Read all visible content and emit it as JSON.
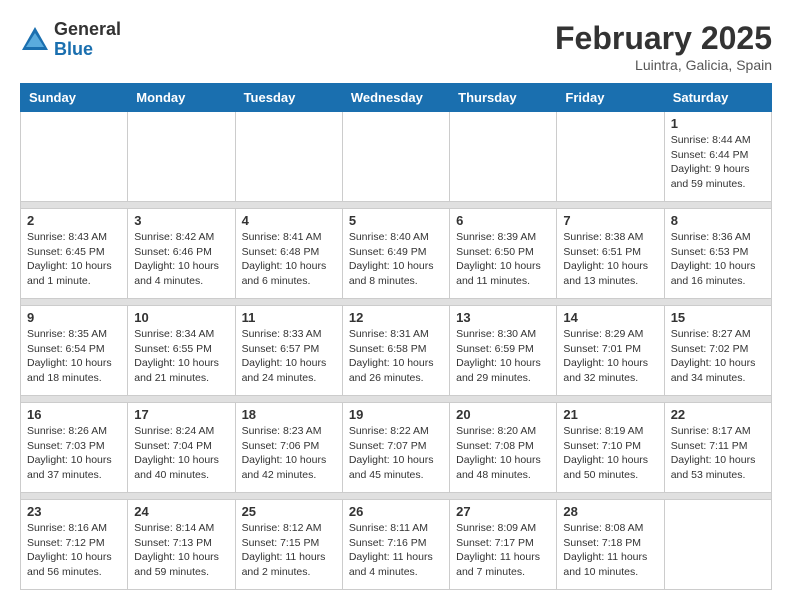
{
  "logo": {
    "general": "General",
    "blue": "Blue"
  },
  "title": {
    "month_year": "February 2025",
    "location": "Luintra, Galicia, Spain"
  },
  "weekdays": [
    "Sunday",
    "Monday",
    "Tuesday",
    "Wednesday",
    "Thursday",
    "Friday",
    "Saturday"
  ],
  "weeks": [
    [
      {
        "day": "",
        "info": ""
      },
      {
        "day": "",
        "info": ""
      },
      {
        "day": "",
        "info": ""
      },
      {
        "day": "",
        "info": ""
      },
      {
        "day": "",
        "info": ""
      },
      {
        "day": "",
        "info": ""
      },
      {
        "day": "1",
        "info": "Sunrise: 8:44 AM\nSunset: 6:44 PM\nDaylight: 9 hours and 59 minutes."
      }
    ],
    [
      {
        "day": "2",
        "info": "Sunrise: 8:43 AM\nSunset: 6:45 PM\nDaylight: 10 hours and 1 minute."
      },
      {
        "day": "3",
        "info": "Sunrise: 8:42 AM\nSunset: 6:46 PM\nDaylight: 10 hours and 4 minutes."
      },
      {
        "day": "4",
        "info": "Sunrise: 8:41 AM\nSunset: 6:48 PM\nDaylight: 10 hours and 6 minutes."
      },
      {
        "day": "5",
        "info": "Sunrise: 8:40 AM\nSunset: 6:49 PM\nDaylight: 10 hours and 8 minutes."
      },
      {
        "day": "6",
        "info": "Sunrise: 8:39 AM\nSunset: 6:50 PM\nDaylight: 10 hours and 11 minutes."
      },
      {
        "day": "7",
        "info": "Sunrise: 8:38 AM\nSunset: 6:51 PM\nDaylight: 10 hours and 13 minutes."
      },
      {
        "day": "8",
        "info": "Sunrise: 8:36 AM\nSunset: 6:53 PM\nDaylight: 10 hours and 16 minutes."
      }
    ],
    [
      {
        "day": "9",
        "info": "Sunrise: 8:35 AM\nSunset: 6:54 PM\nDaylight: 10 hours and 18 minutes."
      },
      {
        "day": "10",
        "info": "Sunrise: 8:34 AM\nSunset: 6:55 PM\nDaylight: 10 hours and 21 minutes."
      },
      {
        "day": "11",
        "info": "Sunrise: 8:33 AM\nSunset: 6:57 PM\nDaylight: 10 hours and 24 minutes."
      },
      {
        "day": "12",
        "info": "Sunrise: 8:31 AM\nSunset: 6:58 PM\nDaylight: 10 hours and 26 minutes."
      },
      {
        "day": "13",
        "info": "Sunrise: 8:30 AM\nSunset: 6:59 PM\nDaylight: 10 hours and 29 minutes."
      },
      {
        "day": "14",
        "info": "Sunrise: 8:29 AM\nSunset: 7:01 PM\nDaylight: 10 hours and 32 minutes."
      },
      {
        "day": "15",
        "info": "Sunrise: 8:27 AM\nSunset: 7:02 PM\nDaylight: 10 hours and 34 minutes."
      }
    ],
    [
      {
        "day": "16",
        "info": "Sunrise: 8:26 AM\nSunset: 7:03 PM\nDaylight: 10 hours and 37 minutes."
      },
      {
        "day": "17",
        "info": "Sunrise: 8:24 AM\nSunset: 7:04 PM\nDaylight: 10 hours and 40 minutes."
      },
      {
        "day": "18",
        "info": "Sunrise: 8:23 AM\nSunset: 7:06 PM\nDaylight: 10 hours and 42 minutes."
      },
      {
        "day": "19",
        "info": "Sunrise: 8:22 AM\nSunset: 7:07 PM\nDaylight: 10 hours and 45 minutes."
      },
      {
        "day": "20",
        "info": "Sunrise: 8:20 AM\nSunset: 7:08 PM\nDaylight: 10 hours and 48 minutes."
      },
      {
        "day": "21",
        "info": "Sunrise: 8:19 AM\nSunset: 7:10 PM\nDaylight: 10 hours and 50 minutes."
      },
      {
        "day": "22",
        "info": "Sunrise: 8:17 AM\nSunset: 7:11 PM\nDaylight: 10 hours and 53 minutes."
      }
    ],
    [
      {
        "day": "23",
        "info": "Sunrise: 8:16 AM\nSunset: 7:12 PM\nDaylight: 10 hours and 56 minutes."
      },
      {
        "day": "24",
        "info": "Sunrise: 8:14 AM\nSunset: 7:13 PM\nDaylight: 10 hours and 59 minutes."
      },
      {
        "day": "25",
        "info": "Sunrise: 8:12 AM\nSunset: 7:15 PM\nDaylight: 11 hours and 2 minutes."
      },
      {
        "day": "26",
        "info": "Sunrise: 8:11 AM\nSunset: 7:16 PM\nDaylight: 11 hours and 4 minutes."
      },
      {
        "day": "27",
        "info": "Sunrise: 8:09 AM\nSunset: 7:17 PM\nDaylight: 11 hours and 7 minutes."
      },
      {
        "day": "28",
        "info": "Sunrise: 8:08 AM\nSunset: 7:18 PM\nDaylight: 11 hours and 10 minutes."
      },
      {
        "day": "",
        "info": ""
      }
    ]
  ]
}
